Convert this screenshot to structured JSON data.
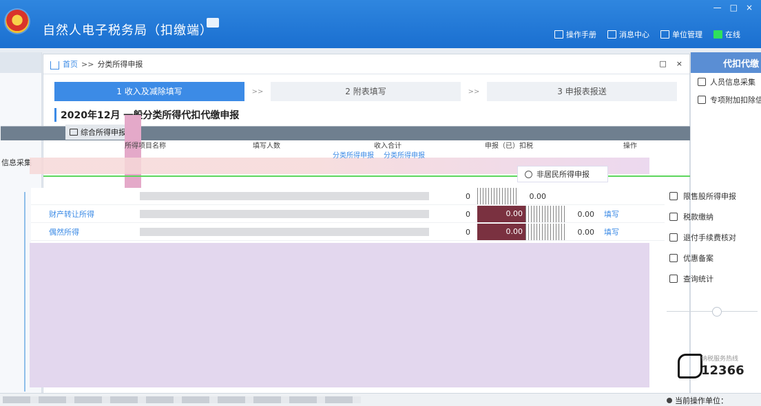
{
  "app": {
    "title": "自然人电子税务局（扣缴端）",
    "window_controls": [
      "—",
      "□",
      "×"
    ]
  },
  "topnav": {
    "manual": "操作手册",
    "messages": "消息中心",
    "unit_mgmt": "单位管理",
    "online": "在线"
  },
  "left_strip": {
    "label": "信息采集"
  },
  "breadcrumb": {
    "home": "首页",
    "sep": ">>",
    "current": "分类所得申报"
  },
  "dialog_buttons": {
    "maximize": "□",
    "close": "×"
  },
  "steps": [
    {
      "label": "1 收入及减除填写",
      "active": true
    },
    {
      "label": "2 附表填写",
      "active": false
    },
    {
      "label": "3 申报表报送",
      "active": false
    }
  ],
  "step_arrow": ">>",
  "declaration_title": "2020年12月 一般分类所得代扣代缴申报",
  "tab_active": "综合所得申报",
  "table_headers": [
    "所得项目名称",
    "填写人数",
    "收入合计",
    "申报（已）扣税",
    "操作"
  ],
  "sub_tabs": [
    "分类所得申报",
    "分类所得申报"
  ],
  "nonresident": "非居民所得申报",
  "income_rows": [
    {
      "name": "",
      "zero": "0",
      "amount": "0.00",
      "action": ""
    },
    {
      "name": "财产转让所得",
      "zero": "0",
      "dark": "0.00",
      "amount": "0.00",
      "action": "填写"
    },
    {
      "name": "偶然所得",
      "zero": "0",
      "dark": "0.00",
      "amount": "0.00",
      "action": "填写"
    }
  ],
  "right_panel": {
    "header": "代扣代缴",
    "items": [
      {
        "label": "人员信息采集",
        "icon": "person-icon"
      },
      {
        "label": "专项附加扣除信息",
        "icon": "list-icon"
      }
    ]
  },
  "side_menu": [
    {
      "label": "限售股所得申报",
      "icon": "chart-icon"
    },
    {
      "label": "税款缴纳",
      "icon": "wallet-icon"
    },
    {
      "label": "退付手续费核对",
      "icon": "receipt-icon"
    },
    {
      "label": "优惠备案",
      "icon": "document-icon"
    },
    {
      "label": "查询统计",
      "icon": "search-list-icon"
    }
  ],
  "hotline": {
    "label": "纳税服务热线",
    "number": "12366"
  },
  "statusbar": {
    "unit_label": "当前操作单位："
  }
}
